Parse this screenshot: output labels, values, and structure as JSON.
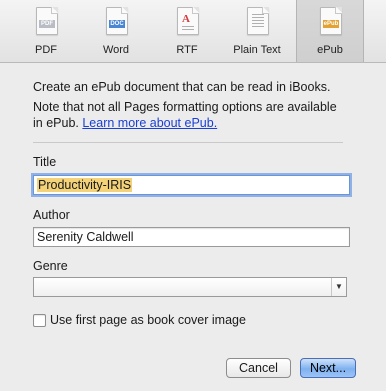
{
  "tabs": [
    {
      "label": "PDF",
      "badge": "PDF",
      "badge_color": "#b9bcc4",
      "selected": false
    },
    {
      "label": "Word",
      "badge": "DOC",
      "badge_color": "#4a86d4",
      "selected": false
    },
    {
      "label": "RTF",
      "badge": "A",
      "badge_color": "#d23c3c",
      "selected": false
    },
    {
      "label": "Plain Text",
      "badge": "",
      "badge_color": "#b0b0b0",
      "selected": false
    },
    {
      "label": "ePub",
      "badge": "ePub",
      "badge_color": "#e3a234",
      "selected": true
    }
  ],
  "description": "Create an ePub document that can be read in iBooks.",
  "note": "Note that not all Pages formatting options are available in ePub.",
  "learn_more": "Learn more about ePub.",
  "title_field": {
    "label": "Title",
    "value": "Productivity-IRIS"
  },
  "author_field": {
    "label": "Author",
    "value": "Serenity Caldwell"
  },
  "genre_field": {
    "label": "Genre",
    "value": ""
  },
  "cover_checkbox": {
    "label": "Use first page as book cover image",
    "checked": false
  },
  "buttons": {
    "cancel": "Cancel",
    "next": "Next..."
  }
}
